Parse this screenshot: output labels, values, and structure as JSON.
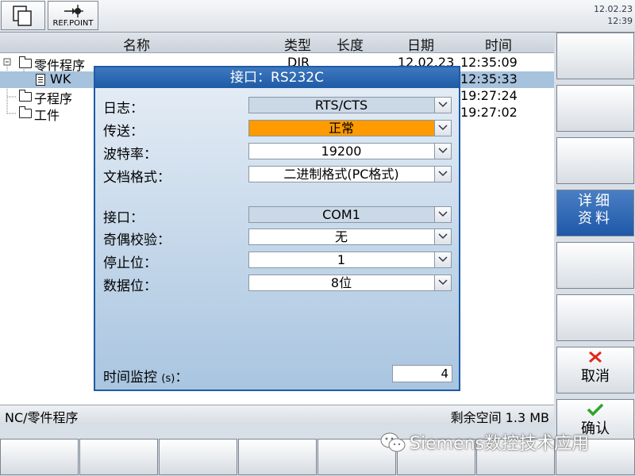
{
  "topbar": {
    "ref_point_label": "REF.POINT",
    "date": "12.02.23",
    "time": "12:39"
  },
  "filelist": {
    "columns": [
      "名称",
      "类型",
      "长度",
      "日期",
      "时间"
    ],
    "rows": [
      {
        "name": "零件程序",
        "type": "DIR",
        "date": "12.02.23",
        "time": "12:35:09"
      },
      {
        "name": "WK",
        "time": "12:35:33"
      },
      {
        "name": "子程序",
        "time": "19:27:24"
      },
      {
        "name": "工件",
        "time": "19:27:02"
      }
    ]
  },
  "dialog": {
    "title": "接口：RS232C",
    "fields": [
      {
        "label": "日志：",
        "value": "RTS/CTS"
      },
      {
        "label": "传送：",
        "value": "正常"
      },
      {
        "label": "波特率：",
        "value": "19200"
      },
      {
        "label": "文档格式：",
        "value": "二进制格式(PC格式)"
      },
      {
        "label": "接口：",
        "value": "COM1"
      },
      {
        "label": "奇偶校验：",
        "value": "无"
      },
      {
        "label": "停止位：",
        "value": "1"
      },
      {
        "label": "数据位：",
        "value": "8位"
      }
    ],
    "timeout_label": "时间监控",
    "timeout_unit": "(s)",
    "timeout_colon": "：",
    "timeout_value": "4"
  },
  "statusbar": {
    "path": "NC/零件程序",
    "free_space": "剩余空间 1.3 MB"
  },
  "softkeys": {
    "details_line1": "详细",
    "details_line2": "资料",
    "cancel": "取消",
    "ok": "确认"
  },
  "watermark": "Siemens数控技术应用",
  "colors": {
    "accent": "#1f5aa6",
    "highlight": "#ff9a00",
    "cancel": "#e0281a",
    "ok": "#2aa52a"
  }
}
